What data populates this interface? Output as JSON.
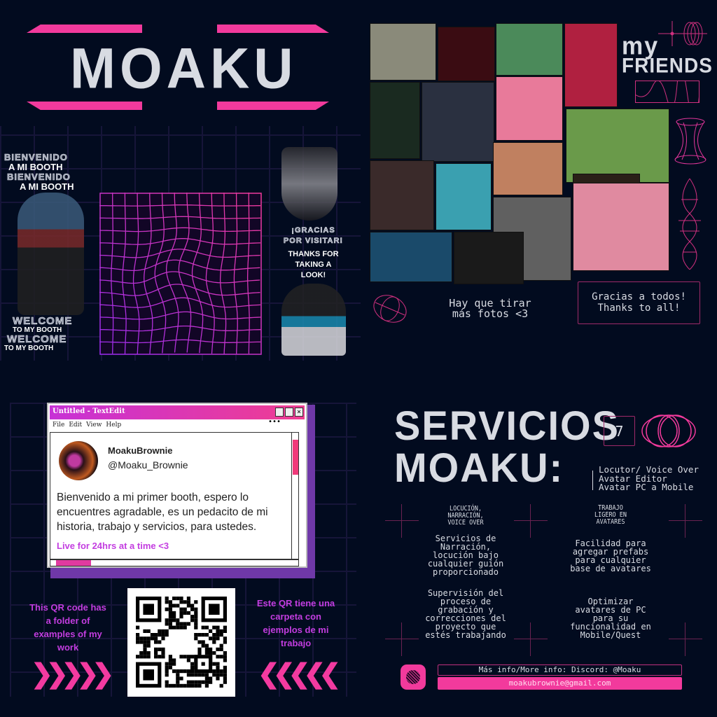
{
  "top_left": {
    "title": "MOAKU",
    "welcome_es": [
      "BIENVENIDO",
      "A MI BOOTH",
      "BIENVENIDO",
      "A MI BOOTH"
    ],
    "welcome_en": [
      "WELCOME",
      "TO MY BOOTH",
      "WELCOME",
      "TO MY BOOTH"
    ],
    "gracias": [
      "¡GRACIAS",
      "POR VISITAR!"
    ],
    "thanks": [
      "THANKS FOR",
      "TAKING A",
      "LOOK!"
    ]
  },
  "top_right": {
    "title_line1": "my",
    "title_line2": "FRIENDS",
    "caption": [
      "Hay que tirar",
      "más fotos <3"
    ],
    "thanks_box": [
      "Gracias a todos!",
      "Thanks to all!"
    ]
  },
  "textedit": {
    "title": "Untitled - TextEdit",
    "menu": [
      "File",
      "Edit",
      "View",
      "Help"
    ],
    "more": "•••",
    "username": "MoakuBrownie",
    "handle": "@Moaku_Brownie",
    "body": "Bienvenido a mi primer booth, espero lo encuentres agradable, es un pedacito de mi historia, trabajo y servicios, para ustedes.",
    "live": "Live for 24hrs at a time <3"
  },
  "qr": {
    "left_text": "This QR code has a folder of examples of my work",
    "right_text": "Este QR tiene una carpeta con ejemplos de mi trabajo"
  },
  "services": {
    "title_line1": "SERVICIOS",
    "title_line2": "MOAKU:",
    "number": "7",
    "list": [
      "Locutor/ Voice Over",
      "Avatar Editor",
      "Avatar PC a Mobile"
    ],
    "col1_heading": [
      "LOCUCIÓN,",
      "NARRACIÓN,",
      "VOICE OVER"
    ],
    "col1_items": [
      "Servicios de Narración, locución bajo cualquier guión proporcionado",
      "Supervisión del proceso de grabación y correcciones del proyecto que estés trabajando"
    ],
    "col2_heading": [
      "TRABAJO",
      "LIGERO EN",
      "AVATARES"
    ],
    "col2_items": [
      "Facilidad para agregar prefabs para cualquier base de avatares",
      "Optimizar avatares de PC para su funcionalidad en Mobile/Quest"
    ],
    "discord": "Más info/More info: Discord: @Moaku",
    "email": "moakubrownie@gmail.com"
  },
  "colors": {
    "accent": "#f23a9c",
    "purple": "#c33de0",
    "bg": "#020b1f"
  }
}
